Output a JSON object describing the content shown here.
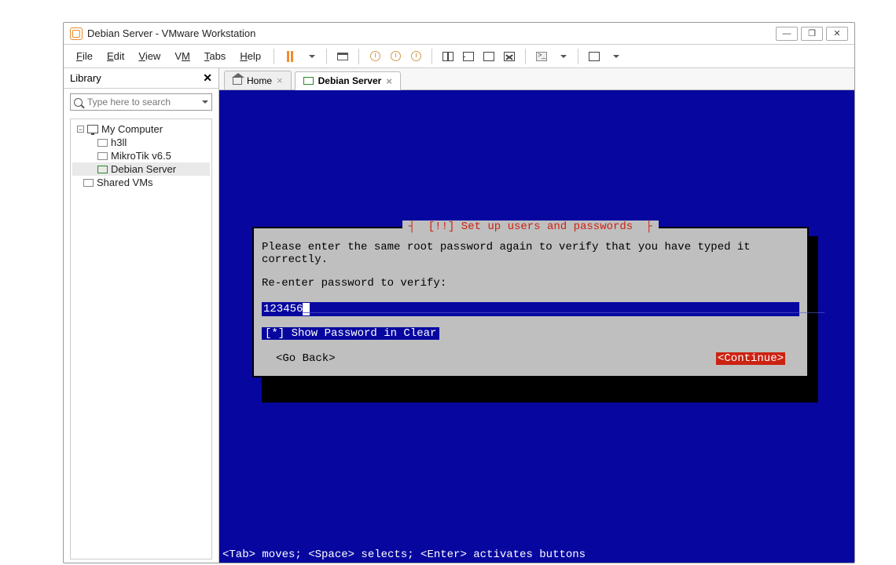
{
  "window": {
    "title": "Debian Server - VMware Workstation",
    "controls": {
      "min": "—",
      "max": "❐",
      "close": "✕"
    }
  },
  "menu": {
    "file": "File",
    "edit": "Edit",
    "view": "View",
    "vm": "VM",
    "tabs": "Tabs",
    "help": "Help"
  },
  "sidebar": {
    "title": "Library",
    "close": "✕",
    "search_placeholder": "Type here to search",
    "root": "My Computer",
    "items": [
      "h3ll",
      "MikroTik v6.5",
      "Debian Server"
    ],
    "shared": "Shared VMs"
  },
  "tabs": {
    "home": "Home",
    "active": "Debian Server"
  },
  "installer": {
    "title": "[!!] Set up users and passwords",
    "line1": "Please enter the same root password again to verify that you have typed it correctly.",
    "line2": "Re-enter password to verify:",
    "password": "123456",
    "show_pw": "[*]  Show Password in Clear",
    "go_back": "<Go Back>",
    "continue": "<Continue>",
    "status": "<Tab> moves; <Space> selects; <Enter> activates buttons"
  }
}
